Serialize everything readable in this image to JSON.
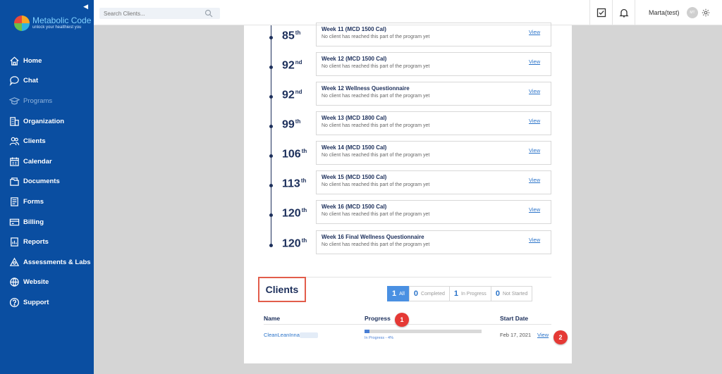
{
  "app": {
    "logo_name": "Metabolic Code",
    "logo_tagline": "unlock your healthiest you",
    "collapse_icon": "◀"
  },
  "sidebar": {
    "items": [
      {
        "label": "Home",
        "icon": "home-icon"
      },
      {
        "label": "Chat",
        "icon": "chat-icon"
      },
      {
        "label": "Programs",
        "icon": "programs-icon"
      },
      {
        "label": "Organization",
        "icon": "organization-icon"
      },
      {
        "label": "Clients",
        "icon": "clients-icon"
      },
      {
        "label": "Calendar",
        "icon": "calendar-icon"
      },
      {
        "label": "Documents",
        "icon": "documents-icon"
      },
      {
        "label": "Forms",
        "icon": "forms-icon"
      },
      {
        "label": "Billing",
        "icon": "billing-icon"
      },
      {
        "label": "Reports",
        "icon": "reports-icon"
      },
      {
        "label": "Assessments & Labs",
        "icon": "assessments-icon"
      },
      {
        "label": "Website",
        "icon": "website-icon"
      },
      {
        "label": "Support",
        "icon": "support-icon"
      }
    ]
  },
  "topbar": {
    "search_placeholder": "Search Clients...",
    "user_name": "Marta(test)",
    "avatar_initials": "MT"
  },
  "timeline": {
    "empty_text": "No client has reached this part of the program yet",
    "view_label": "View",
    "entries": [
      {
        "day": "85",
        "suffix": "th",
        "title": "Week 11 (MCD 1500 Cal)"
      },
      {
        "day": "92",
        "suffix": "nd",
        "title": "Week 12 (MCD 1500 Cal)"
      },
      {
        "day": "92",
        "suffix": "nd",
        "title": "Week 12 Wellness Questionnaire"
      },
      {
        "day": "99",
        "suffix": "th",
        "title": "Week 13 (MCD 1800 Cal)"
      },
      {
        "day": "106",
        "suffix": "th",
        "title": "Week 14 (MCD 1500 Cal)"
      },
      {
        "day": "113",
        "suffix": "th",
        "title": "Week 15 (MCD 1500 Cal)"
      },
      {
        "day": "120",
        "suffix": "th",
        "title": "Week 16 (MCD 1500 Cal)"
      },
      {
        "day": "120",
        "suffix": "th",
        "title": "Week 16 Final Wellness Questionnaire"
      }
    ]
  },
  "clients_section": {
    "title": "Clients",
    "filters": [
      {
        "count": "1",
        "label": "All",
        "active": true
      },
      {
        "count": "0",
        "label": "Completed",
        "active": false
      },
      {
        "count": "1",
        "label": "In Progress",
        "active": false
      },
      {
        "count": "0",
        "label": "Not Started",
        "active": false
      }
    ],
    "columns": {
      "name": "Name",
      "progress": "Progress",
      "start_date": "Start Date"
    },
    "rows": [
      {
        "name": "CleanLeanInna",
        "progress_fraction": 0.04,
        "progress_label": "In Progress - 4%",
        "start_date": "Feb 17, 2021",
        "view_label": "View"
      }
    ]
  },
  "markers": {
    "one": "1",
    "two": "2"
  },
  "colors": {
    "sidebar_bg": "#0a4ea1",
    "accent": "#4a90e2",
    "marker": "#e53935",
    "title_navy": "#1c2f5b"
  }
}
